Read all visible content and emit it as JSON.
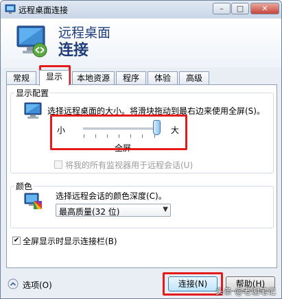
{
  "window": {
    "title": "远程桌面连接",
    "minimize": "–",
    "maximize": "□",
    "close": "✕"
  },
  "header": {
    "line1": "远程桌面",
    "line2": "连接"
  },
  "tabs": [
    {
      "label": "常规",
      "active": false
    },
    {
      "label": "显示",
      "active": true
    },
    {
      "label": "本地资源",
      "active": false
    },
    {
      "label": "程序",
      "active": false
    },
    {
      "label": "体验",
      "active": false
    },
    {
      "label": "高级",
      "active": false
    }
  ],
  "display_config": {
    "legend": "显示配置",
    "description": "选择远程桌面的大小。将滑块拖动到最右边来使用全屏(S)。",
    "slider_min_label": "小",
    "slider_max_label": "大",
    "slider_value_label": "全屏",
    "slider_level": 1.0,
    "multi_monitor_label": "将我的所有监视器用于远程会话(U)",
    "multi_monitor_checked": false
  },
  "colors": {
    "legend": "颜色",
    "description": "选择远程会话的颜色深度(C)。",
    "selected": "最高质量(32 位)"
  },
  "connection_bar": {
    "label": "全屏显示时显示连接栏(B)",
    "checked": true
  },
  "footer": {
    "options_label": "选项(O)",
    "connect_label": "连接(N)",
    "help_label": "帮助(H)"
  },
  "watermark": "头条 @老谢笔记",
  "highlight_color": "#e51b1b"
}
